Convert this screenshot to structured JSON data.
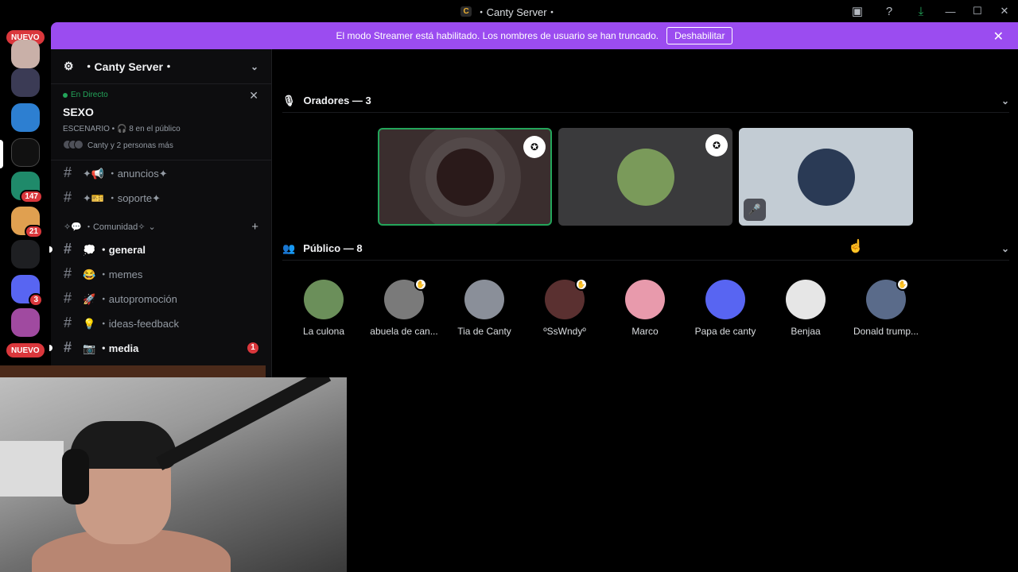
{
  "window": {
    "title": "・Canty Server・",
    "logo_text": "C"
  },
  "banner": {
    "text": "El modo Streamer está habilitado. Los nombres de usuario se han truncado.",
    "button": "Deshabilitar"
  },
  "guilds": {
    "new_label_1": "NUEVO",
    "new_label_2": "NUEVO",
    "badges": [
      "147",
      "21",
      "3"
    ]
  },
  "server": {
    "name": "・Canty Server・"
  },
  "live": {
    "label": "En Directo",
    "topic": "SEXO",
    "meta": "ESCENARIO • 🎧 8 en el público",
    "people": "Canty y 2 personas más"
  },
  "channels_top": [
    {
      "name": "✦📢 ・anuncios✦"
    },
    {
      "name": "✦🎫 ・soporte✦"
    }
  ],
  "category": {
    "label": "✧💬 ・Comunidad✧"
  },
  "channels": [
    {
      "name": "💭 ・general"
    },
    {
      "name": "😂 ・memes"
    },
    {
      "name": "🚀 ・autopromoción"
    },
    {
      "name": "💡 ・ideas-feedback"
    },
    {
      "name": "📷 ・media",
      "mentions": "1"
    }
  ],
  "speakers": {
    "heading": "Oradores — 3"
  },
  "audience": {
    "heading": "Público — 8",
    "members": [
      {
        "name": "La culona",
        "color": "#6b8f5a"
      },
      {
        "name": "abuela de can...",
        "color": "#7a7a7a"
      },
      {
        "name": "Tia de Canty",
        "color": "#8a8f99"
      },
      {
        "name": "ºSsWndyº",
        "color": "#5a3030"
      },
      {
        "name": "Marco",
        "color": "#e89aac"
      },
      {
        "name": "Papa de canty",
        "color": "#5865f2"
      },
      {
        "name": "Benjaa",
        "color": "#e6e6e6"
      },
      {
        "name": "Donald trump...",
        "color": "#5a6b8a"
      }
    ]
  },
  "colors": {
    "accent": "#9b4cf0",
    "live": "#23a55a",
    "mention": "#da373c"
  }
}
